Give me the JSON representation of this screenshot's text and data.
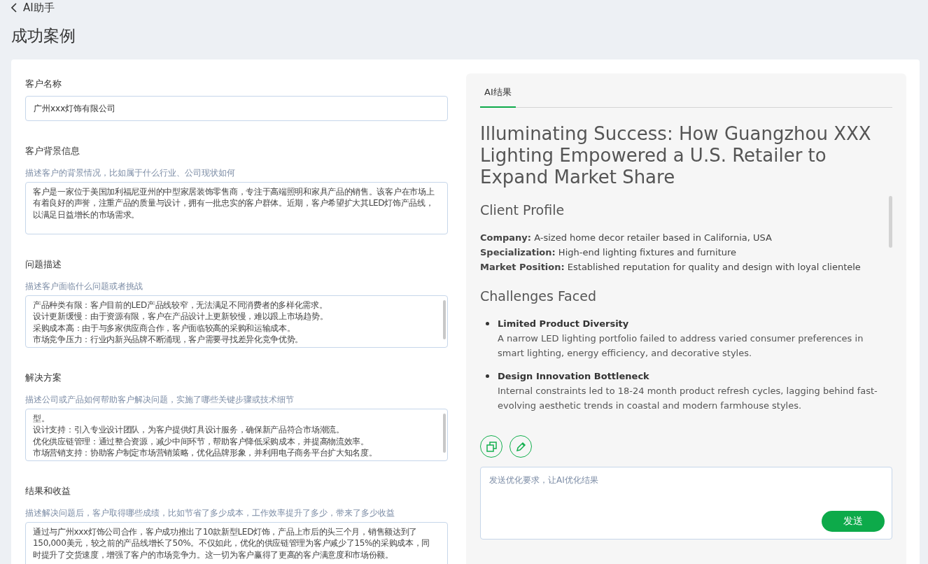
{
  "header": {
    "back_label": "AI助手",
    "title": "成功案例"
  },
  "form": [
    {
      "label": "客户名称",
      "kind": "input",
      "value": "广州xxx灯饰有限公司"
    },
    {
      "label": "客户背景信息",
      "kind": "textarea",
      "hint": "描述客户的背景情况，比如属于什么行业、公司现状如何",
      "lines": [
        "客户是一家位于美国加利福尼亚州的中型家居装饰零售商，专注于高端照明和家具产品的销售。该客户在市场上有着良好的声誉，注重产品的质量与设计，拥有一批忠实的客户群体。近期，客户希望扩大其LED灯饰产品线，以满足日益增长的市场需求。"
      ],
      "scrollbar": false
    },
    {
      "label": "问题描述",
      "kind": "textarea",
      "hint": "描述客户面临什么问题或者挑战",
      "lines": [
        "产品种类有限：客户目前的LED产品线较窄，无法满足不同消费者的多样化需求。",
        "设计更新缓慢：由于资源有限，客户在产品设计上更新较慢，难以跟上市场趋势。",
        "采购成本高：由于与多家供应商合作，客户面临较高的采购和运输成本。",
        "市场竞争压力：行业内新兴品牌不断涌现，客户需要寻找差异化竞争优势。"
      ],
      "scrollbar": true
    },
    {
      "label": "解决方案",
      "kind": "textarea",
      "hint": "描述公司或产品如何帮助客户解决问题，实施了哪些关键步骤或技术细节",
      "lines": [
        "型。",
        "设计支持：引入专业设计团队，为客户提供灯具设计服务，确保新产品符合市场潮流。",
        "优化供应链管理：通过整合资源，减少中间环节，帮助客户降低采购成本，并提高物流效率。",
        "市场营销支持：协助客户制定市场营销策略，优化品牌形象，并利用电子商务平台扩大知名度。"
      ],
      "scrollbar": true
    },
    {
      "label": "结果和收益",
      "kind": "textarea",
      "hint": "描述解决问题后，客户取得哪些成绩，比如节省了多少成本，工作效率提升了多少，带来了多少收益",
      "lines": [
        "通过与广州xxx灯饰公司合作，客户成功推出了10款新型LED灯饰，产品上市后的头三个月，销售额达到了150,000美元，较之前的产品线增长了50%。不仅如此，优化的供应链管理为客户减少了15%的采购成本，同时提升了交货速度，增强了客户的市场竞争力。这一切为客户赢得了更高的客户满意度和市场份额。"
      ],
      "scrollbar": false
    }
  ],
  "result_panel": {
    "tabs": [
      {
        "label": "AI结果",
        "selected": true
      }
    ],
    "content": [
      {
        "kind": "title",
        "text": "Illuminating Success: How Guangzhou XXX Lighting Empowered a U.S. Retailer to Expand Market Share"
      },
      {
        "kind": "heading",
        "text": "Client Profile"
      },
      {
        "kind": "fields",
        "items": [
          "**Company:** A-sized home decor retailer based in California, USA",
          "**Specialization:** High-end lighting fixtures and furniture",
          "**Market Position:** Established reputation for quality and design with loyal clientele"
        ]
      },
      {
        "kind": "heading",
        "text": "Challenges Faced"
      },
      {
        "kind": "bullets",
        "items": [
          {
            "title": "Limited Product Diversity",
            "text": "A narrow LED lighting portfolio failed to address varied consumer preferences in smart lighting, energy efficiency, and decorative styles."
          },
          {
            "title": "Design Innovation Bottleneck",
            "text": "Internal constraints led to 18-24 month product refresh cycles, lagging behind fast-evolving aesthetic trends in coastal and modern farmhouse styles."
          }
        ]
      }
    ],
    "prompt": {
      "placeholder": "发送优化要求，让AI优化结果"
    },
    "send_button": "发送"
  }
}
